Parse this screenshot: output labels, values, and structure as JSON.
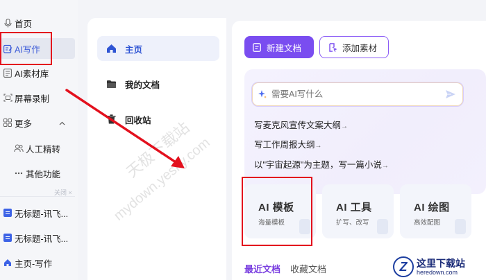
{
  "sidebar": {
    "items": [
      {
        "label": "首页",
        "icon": "microphone-icon"
      },
      {
        "label": "AI写作",
        "icon": "edit-icon"
      },
      {
        "label": "AI素材库",
        "icon": "library-icon"
      },
      {
        "label": "屏幕录制",
        "icon": "screen-record-icon"
      },
      {
        "label": "更多",
        "icon": "grid-icon"
      },
      {
        "label": "人工精转",
        "icon": "people-icon"
      },
      {
        "label": "其他功能",
        "icon": "ellipsis-icon"
      }
    ],
    "close_label": "关闭 ×",
    "docs": [
      {
        "label": "无标题-讯飞..."
      },
      {
        "label": "无标题-讯飞..."
      },
      {
        "label": "主页-写作"
      }
    ]
  },
  "mid_nav": {
    "items": [
      {
        "label": "主页"
      },
      {
        "label": "我的文档"
      },
      {
        "label": "回收站"
      }
    ]
  },
  "main": {
    "new_doc_label": "新建文档",
    "add_material_label": "添加素材",
    "ai_input_placeholder": "需要AI写什么",
    "suggestions": [
      "写麦克风宣传文案大纲",
      "写工作周报大纲",
      "以\"宇宙起源\"为主题，写一篇小说"
    ],
    "tools": [
      {
        "title": "AI 模板",
        "subtitle": "海量模板"
      },
      {
        "title": "AI 工具",
        "subtitle": "扩写、改写"
      },
      {
        "title": "AI 绘图",
        "subtitle": "高效配图"
      }
    ],
    "tabs": [
      "最近文档",
      "收藏文档"
    ]
  },
  "watermarks": [
    "天极下载站",
    "mydown.yesky.com"
  ],
  "logo": {
    "cn": "这里下载站",
    "en": "heredown.com",
    "letter": "Z"
  },
  "colors": {
    "accent": "#7a4df0",
    "active_blue": "#2f55d4",
    "annotation_red": "#e3101d"
  }
}
